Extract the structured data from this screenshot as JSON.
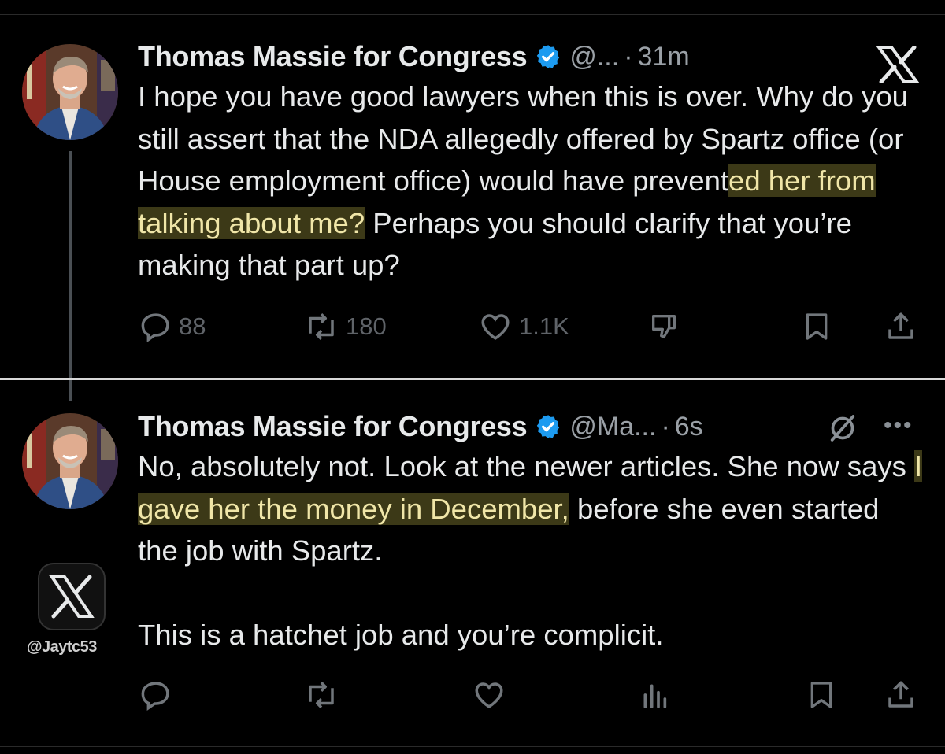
{
  "tweet1": {
    "name": "Thomas Massie for Congress",
    "handle": "@...",
    "sep": "·",
    "time": "31m",
    "text_before_highlight": "I hope you have good lawyers when this is over. Why do you still assert that the NDA allegedly offered by Spartz office (or House employment office) would have prevent",
    "text_highlight": "ed her from talking about me?",
    "text_after_highlight": " Perhaps you should clarify that you’re making that part up?",
    "replies": "88",
    "reposts": "180",
    "likes": "1.1K"
  },
  "tweet2": {
    "name": "Thomas Massie for Congress",
    "handle": "@Ma...",
    "sep": "·",
    "time": "6s",
    "text_before_highlight": "No, absolutely not. Look at the newer articles. She now says ",
    "text_highlight": "I gave her the money in December,",
    "text_after_highlight": " before she even started the job with Spartz.",
    "text_paragraph2": "This is a hatchet job and you’re complicit.",
    "more_label": "•••"
  },
  "watermark": "@Jaytc53",
  "colors": {
    "background": "#000000",
    "text": "#e7e9ea",
    "secondary": "#9aa0a6",
    "verified": "#1d9bf0",
    "highlight": "#6e682a"
  },
  "icons": [
    "verified-badge-icon",
    "x-logo-icon",
    "reply-icon",
    "repost-icon",
    "like-icon",
    "dislike-icon",
    "views-icon",
    "bookmark-icon",
    "share-icon",
    "mute-icon",
    "more-icon"
  ]
}
